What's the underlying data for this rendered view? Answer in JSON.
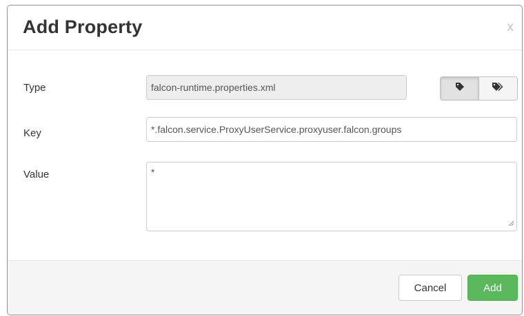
{
  "dialog": {
    "title": "Add Property",
    "close_label": "x"
  },
  "form": {
    "type": {
      "label": "Type",
      "value": "falcon-runtime.properties.xml",
      "toggle_icons": [
        "tag-icon",
        "tags-icon"
      ],
      "active_toggle": "tag-icon"
    },
    "key": {
      "label": "Key",
      "value": "*.falcon.service.ProxyUserService.proxyuser.falcon.groups"
    },
    "value": {
      "label": "Value",
      "value": "*"
    }
  },
  "footer": {
    "cancel_label": "Cancel",
    "add_label": "Add",
    "add_color": "#5cb85c"
  }
}
